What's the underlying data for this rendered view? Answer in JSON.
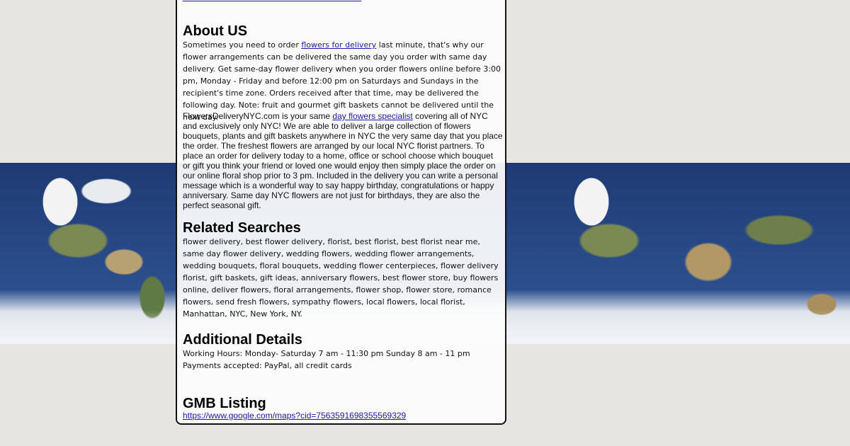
{
  "about": {
    "heading": "About US",
    "p1_before": "Sometimes you need to order ",
    "p1_link": "flowers for delivery",
    "p1_after": " last minute, that's why our flower arrangements can be delivered the same day you order with same day delivery. Get same-day flower delivery when you order flowers online before 3:00 pm, Monday - Friday and before 12:00 pm on Saturdays and Sundays in the recipient's time zone. Orders received after that time, may be delivered the following day. Note: fruit and gourmet gift baskets cannot be delivered until the next day.",
    "p2_before": "FlowersDeliveryNYC.com is your same ",
    "p2_link": "day flowers specialist",
    "p2_after": " covering all of NYC and exclusively only NYC! We are able to deliver a large collection of flowers bouquets, plants and gift baskets anywhere in NYC the very same day that you place the order. The freshest flowers are arranged by our local NYC florist partners. To place an order for delivery today to a home, office or school choose which bouquet or gift you think your friend or loved one would enjoy then simply place the order on our online floral shop prior to 3 pm. Included in the delivery you can write a personal message which is a wonderful way to say happy birthday, congratulations or happy anniversary. Same day NYC flowers are not just for birthdays, they are also the perfect seasonal gift."
  },
  "related": {
    "heading": "Related Searches",
    "text": "flower delivery, best flower delivery, florist, best florist, best florist near me, same day flower delivery, wedding flowers, wedding flower arrangements, wedding bouquets, floral bouquets, wedding flower centerpieces, flower delivery florist, gift baskets, gift ideas, anniversary flowers, best flower store, buy flowers online, deliver flowers, floral arrangements, flower shop, flower store, romance flowers, send fresh flowers, sympathy flowers, local flowers, local florist, Manhattan, NYC, New York, NY."
  },
  "additional": {
    "heading": "Additional Details",
    "hours": "Working Hours: Monday- Saturday 7 am - 11:30 pm Sunday 8 am - 11 pm",
    "payments": "Payments accepted: PayPal, all credit cards"
  },
  "gmb": {
    "heading": "GMB Listing",
    "link": "https://www.google.com/maps?cid=7563591698355569329"
  }
}
